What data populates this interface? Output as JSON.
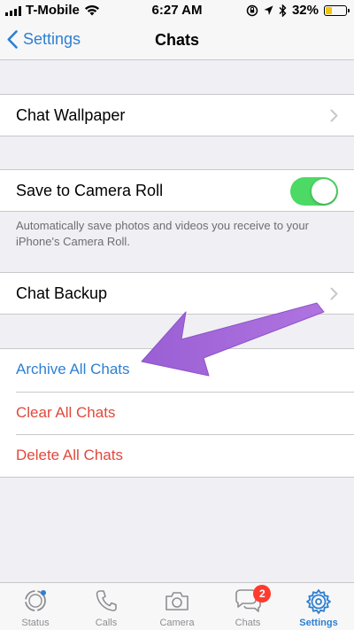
{
  "status_bar": {
    "carrier": "T-Mobile",
    "time": "6:27 AM",
    "battery": "32%",
    "battery_level": 0.32
  },
  "nav": {
    "back_label": "Settings",
    "title": "Chats"
  },
  "settings": {
    "chat_wallpaper": "Chat Wallpaper",
    "save_to_camera_roll": "Save to Camera Roll",
    "save_to_camera_roll_on": true,
    "save_footnote": "Automatically save photos and videos you receive to your iPhone's Camera Roll.",
    "chat_backup": "Chat Backup"
  },
  "actions": {
    "archive_all": "Archive All Chats",
    "clear_all": "Clear All Chats",
    "delete_all": "Delete All Chats"
  },
  "tabs": [
    {
      "label": "Status",
      "icon": "status-icon"
    },
    {
      "label": "Calls",
      "icon": "phone-icon"
    },
    {
      "label": "Camera",
      "icon": "camera-icon"
    },
    {
      "label": "Chats",
      "icon": "chat-bubbles-icon",
      "badge": "2"
    },
    {
      "label": "Settings",
      "icon": "gear-icon",
      "active": true
    }
  ],
  "colors": {
    "accent": "#2e7fd1",
    "destructive": "#e0483b",
    "toggle_on": "#4cd964",
    "annotation_arrow": "#a467d8"
  }
}
